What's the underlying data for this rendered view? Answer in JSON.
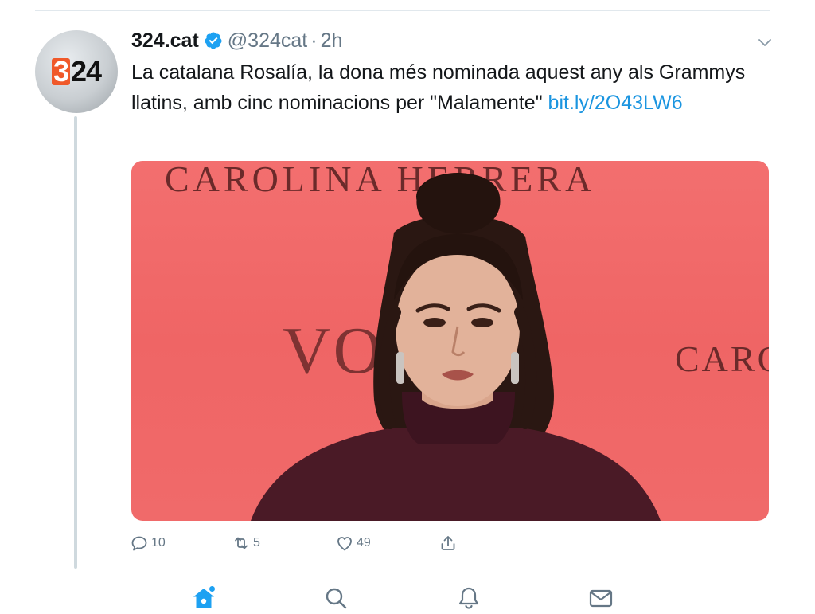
{
  "tweet": {
    "author_name": "324.cat",
    "verified": true,
    "handle": "@324cat",
    "separator": "·",
    "time": "2h",
    "avatar_logo": {
      "three": "3",
      "rest": "24"
    },
    "text": "La catalana Rosalía, la dona més nominada aquest any als Grammys llatins, amb cinc nominacions per \"Malamente\" ",
    "link_text": "bit.ly/2O43LW6",
    "media": {
      "backdrop_text_top": "CAROLINA HERRERA",
      "backdrop_text_left": "VO",
      "backdrop_text_right": "CARO"
    }
  },
  "actions": {
    "reply_count": "10",
    "retweet_count": "5",
    "like_count": "49"
  },
  "tabbar": {
    "items": [
      {
        "name": "home",
        "icon": "home-icon",
        "active": true
      },
      {
        "name": "search",
        "icon": "search-icon",
        "active": false
      },
      {
        "name": "notifications",
        "icon": "bell-icon",
        "active": false
      },
      {
        "name": "messages",
        "icon": "envelope-icon",
        "active": false
      }
    ]
  },
  "colors": {
    "accent": "#1da1f2",
    "link": "#1b95e0",
    "muted": "#657786",
    "media_background": "#f06a6a"
  }
}
